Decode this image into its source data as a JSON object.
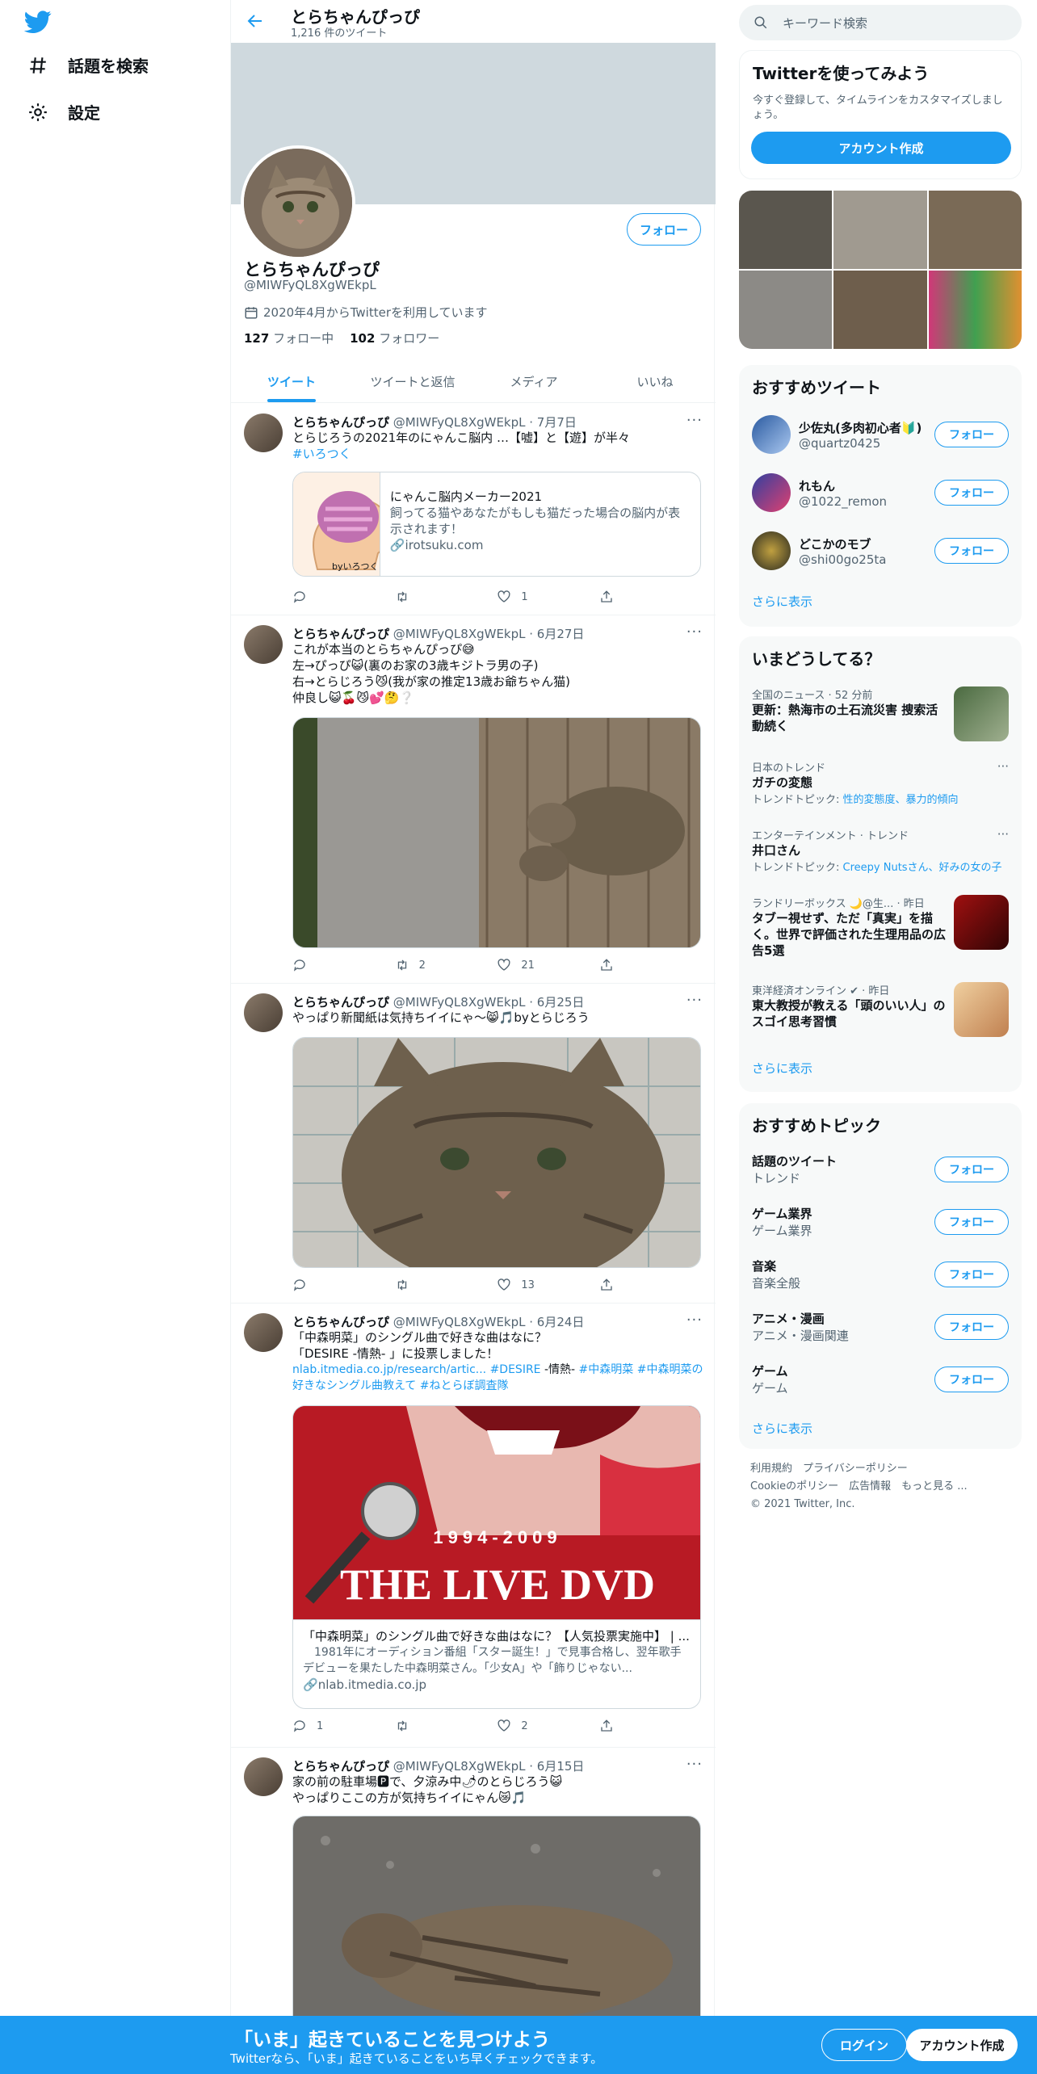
{
  "nav": {
    "explore_label": "話題を検索",
    "settings_label": "設定"
  },
  "profile": {
    "topbar_name": "とらちゃんぴっぴ",
    "tweet_count": "1,216 件のツイート",
    "follow_label": "フォロー",
    "name": "とらちゃんぴっぴ",
    "handle": "@MIWFyQL8XgWEkpL",
    "joined": "2020年4月からTwitterを利用しています",
    "following_count": "127",
    "following_label": "フォロー中",
    "followers_count": "102",
    "followers_label": "フォロワー",
    "tabs": [
      "ツイート",
      "ツイートと返信",
      "メディア",
      "いいね"
    ]
  },
  "tweets": [
    {
      "name": "とらちゃんぴっぴ",
      "meta": "@MIWFyQL8XgWEkpL · 7月7日",
      "text": "とらじろうの2021年のにゃんこ脳内 …【嘘】と【遊】が半々",
      "hashtag": "#いろつく",
      "card": {
        "title": "にゃんこ脳内メーカー2021",
        "desc": "飼ってる猫やあなたがもしも猫だった場合の脳内が表示されます！",
        "domain": "irotsuku.com",
        "thumb_label": "byいろつく"
      },
      "replies": "",
      "retweets": "",
      "likes": "1"
    },
    {
      "name": "とらちゃんぴっぴ",
      "meta": "@MIWFyQL8XgWEkpL · 6月27日",
      "text": "これが本当のとらちゃんぴっぴ😅\n左→ぴっぴ😺(裏のお家の3歳キジトラ男の子)\n右→とらじろう😼(我が家の推定13歳お爺ちゃん猫)\n仲良し😺🍒😼💕🤔❔",
      "replies": "",
      "retweets": "2",
      "likes": "21"
    },
    {
      "name": "とらちゃんぴっぴ",
      "meta": "@MIWFyQL8XgWEkpL · 6月25日",
      "text": "やっぱり新聞紙は気持ちイイにゃ～😸🎵byとらじろう",
      "replies": "",
      "retweets": "",
      "likes": "13"
    },
    {
      "name": "とらちゃんぴっぴ",
      "meta": "@MIWFyQL8XgWEkpL · 6月24日",
      "text": "「中森明菜」のシングル曲で好きな曲はなに？\n「DESIRE -情熱- 」に投票しました！",
      "link1": "nlab.itmedia.co.jp/research/artic...",
      "link2": "#DESIRE",
      "plain1": " -情熱- ",
      "link3": "#中森明菜 #中森明菜の好きなシングル曲教えて #ねとらぼ調査隊",
      "card": {
        "years": "1994-2009",
        "headline": "THE LIVE DVD",
        "title": "「中森明菜」のシングル曲で好きな曲はなに？【人気投票実施中】 | ...",
        "desc": "　1981年にオーディション番組「スター誕生！」で見事合格し、翌年歌手デビューを果たした中森明菜さん。「少女A」や「飾りじゃない...",
        "domain": "nlab.itmedia.co.jp"
      },
      "replies": "1",
      "retweets": "",
      "likes": "2"
    },
    {
      "name": "とらちゃんぴっぴ",
      "meta": "@MIWFyQL8XgWEkpL · 6月15日",
      "text": "家の前の駐車場🅿で、夕涼み中🌶のとらじろう😺\nやっぱりここの方が気持ちイイにゃん😿🎵"
    }
  ],
  "right": {
    "search_placeholder": "キーワード検索",
    "signup_title": "Twitterを使ってみよう",
    "signup_desc": "今すぐ登録して、タイムラインをカスタマイズしましょう。",
    "signup_button": "アカウント作成",
    "recommended_title": "おすすめツイート",
    "recommended": [
      {
        "name": "少佐丸(多肉初心者🔰)",
        "handle": "@quartz0425"
      },
      {
        "name": "れもん",
        "handle": "@1022_remon"
      },
      {
        "name": "どこかのモブ",
        "handle": "@shi00go25ta"
      }
    ],
    "follow_label": "フォロー",
    "show_more": "さらに表示",
    "trends_title": "いまどうしてる？",
    "trends": [
      {
        "context": "全国のニュース · 52 分前",
        "title": "更新：熱海市の土石流災害 捜索活動続く",
        "sub": ""
      },
      {
        "context": "日本のトレンド",
        "title": "ガチの変態",
        "sub_prefix": "トレンドトピック: ",
        "sub_links": "性的変態度、暴力的傾向"
      },
      {
        "context": "エンターテインメント · トレンド",
        "title": "井口さん",
        "sub_prefix": "トレンドトピック: ",
        "sub_links": "Creepy Nutsさん、好みの女の子"
      },
      {
        "context": "ランドリーボックス 🌙@生... · 昨日",
        "title": "タブー視せず、ただ「真実」を描く。世界で評価された生理用品の広告5選",
        "sub": ""
      },
      {
        "context": "東洋経済オンライン ✔ · 昨日",
        "title": "東大教授が教える「頭のいい人」のスゴイ思考習慣",
        "sub": ""
      }
    ],
    "topics_title": "おすすめトピック",
    "topics": [
      {
        "name": "話題のツイート",
        "cat": "トレンド"
      },
      {
        "name": "ゲーム業界",
        "cat": "ゲーム業界"
      },
      {
        "name": "音楽",
        "cat": "音楽全般"
      },
      {
        "name": "アニメ・漫画",
        "cat": "アニメ・漫画関連"
      },
      {
        "name": "ゲーム",
        "cat": "ゲーム"
      }
    ],
    "footer_line1": "利用規約　プライバシーポリシー",
    "footer_line2": "Cookieのポリシー　広告情報　もっと見る ...",
    "footer_line3": "© 2021 Twitter, Inc."
  },
  "bottom": {
    "title": "「いま」起きていることを見つけよう",
    "subtitle": "Twitterなら、「いま」起きていることをいち早くチェックできます。",
    "login": "ログイン",
    "signup": "アカウント作成"
  },
  "colors": {
    "accent": "#1d9bf0",
    "text": "#0f1419",
    "muted": "#536471"
  }
}
